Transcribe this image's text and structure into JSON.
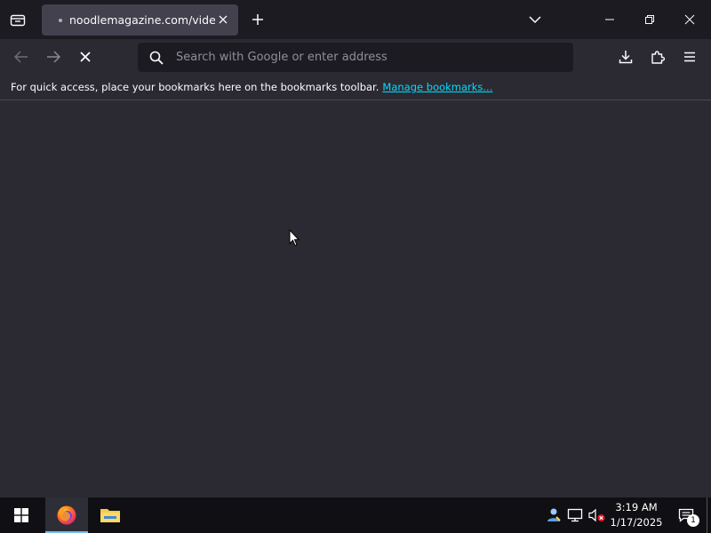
{
  "browser": {
    "tab": {
      "title": "noodlemagazine.com/video/m"
    },
    "urlbar": {
      "placeholder": "Search with Google or enter address",
      "value": ""
    },
    "bookmarks_bar": {
      "message": "For quick access, place your bookmarks here on the bookmarks toolbar.",
      "link": "Manage bookmarks..."
    },
    "page_state": "loading"
  },
  "icons": {
    "tab_list": "tab-list-icon",
    "new_tab": "plus-icon",
    "back": "arrow-left-icon",
    "forward": "arrow-right-icon",
    "stop": "close-icon",
    "search": "search-icon",
    "downloads": "download-icon",
    "extensions": "puzzle-icon",
    "menu": "hamburger-icon"
  },
  "taskbar": {
    "clock": {
      "time": "3:19 AM",
      "date": "1/17/2025"
    },
    "notification_count": "1"
  },
  "colors": {
    "tab_strip": "#1c1b22",
    "toolbar": "#2b2a33",
    "active_tab": "#42414d",
    "link": "#00ddff",
    "taskbar": "#101014"
  }
}
